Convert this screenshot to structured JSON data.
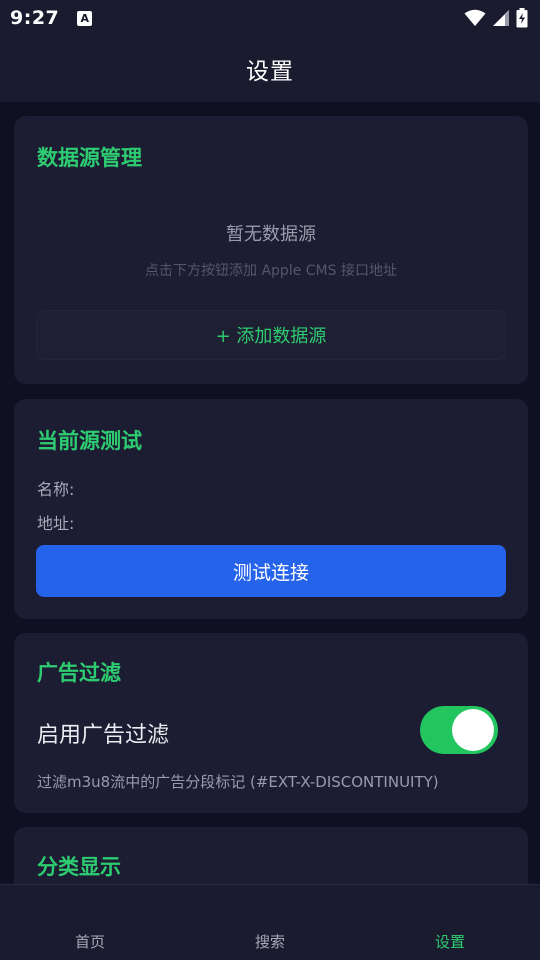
{
  "status": {
    "time": "9:27",
    "app_badge": "A"
  },
  "header": {
    "title": "设置"
  },
  "sources": {
    "title": "数据源管理",
    "empty_title": "暂无数据源",
    "empty_hint": "点击下方按钮添加 Apple CMS 接口地址",
    "add_label": "+ 添加数据源"
  },
  "test": {
    "title": "当前源测试",
    "name_label": "名称:",
    "url_label": "地址:",
    "button_label": "测试连接"
  },
  "ad_filter": {
    "title": "广告过滤",
    "toggle_label": "启用广告过滤",
    "enabled": true,
    "description": "过滤m3u8流中的广告分段标记 (#EXT-X-DISCONTINUITY)"
  },
  "category": {
    "title": "分类显示"
  },
  "nav": {
    "home": "首页",
    "search": "搜索",
    "settings": "设置",
    "active": "settings"
  },
  "colors": {
    "accent": "#2ecc71",
    "primary_button": "#2563eb",
    "toggle_on": "#22c55e",
    "background": "#0f1122",
    "card": "#1c1d32"
  }
}
